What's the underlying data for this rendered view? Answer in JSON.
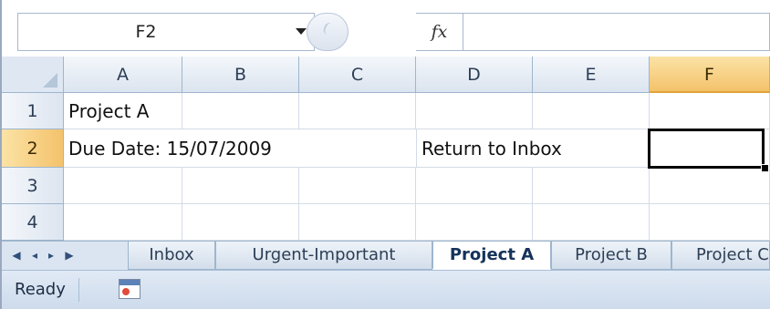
{
  "formula_bar": {
    "name_box_value": "F2",
    "fx_label": "fx",
    "formula_value": ""
  },
  "columns": [
    "A",
    "B",
    "C",
    "D",
    "E",
    "F"
  ],
  "selected_column": "F",
  "rows": [
    "1",
    "2",
    "3",
    "4"
  ],
  "selected_row": "2",
  "cells": {
    "A1": "Project A",
    "A2": "Due Date: 15/07/2009",
    "D2": "Return to Inbox"
  },
  "active_cell": "F2",
  "sheet_tabs": [
    {
      "label": "Inbox",
      "active": false
    },
    {
      "label": "Urgent-Important",
      "active": false
    },
    {
      "label": "Project A",
      "active": true
    },
    {
      "label": "Project B",
      "active": false
    },
    {
      "label": "Project C",
      "active": false
    }
  ],
  "tab_nav_icons": [
    "first-sheet-icon",
    "prev-sheet-icon",
    "next-sheet-icon",
    "last-sheet-icon"
  ],
  "status_bar": {
    "status_text": "Ready",
    "macro_icon": "record-macro-icon"
  },
  "colors": {
    "selected_header": "#f4c26b",
    "header_bg": "#dbe4ef",
    "grid_line": "#d4dbe5",
    "accent": "#9eb6ce"
  }
}
